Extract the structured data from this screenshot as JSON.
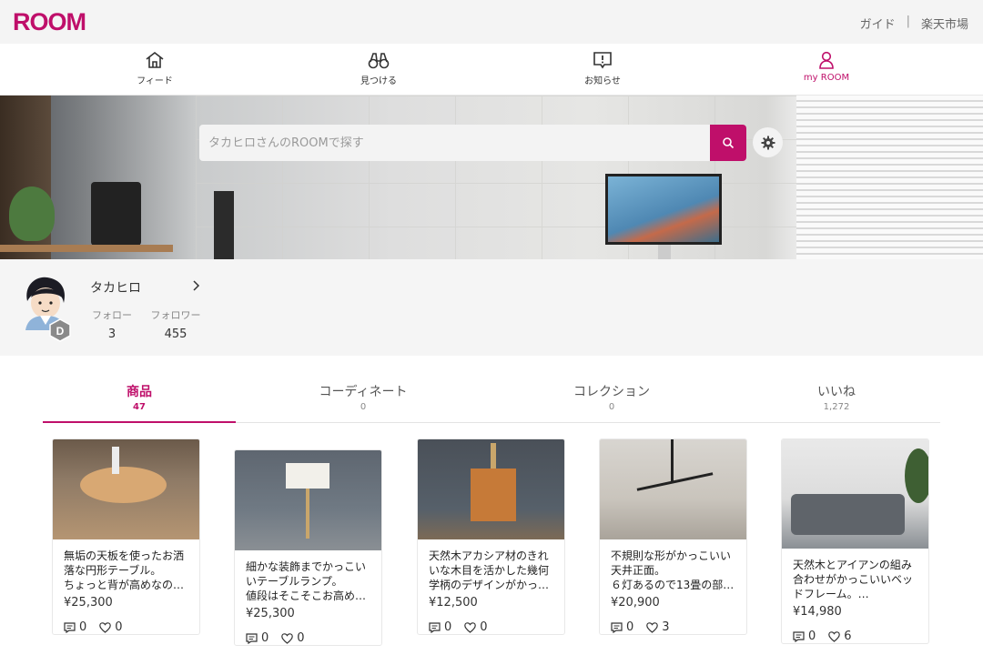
{
  "header": {
    "logo": "ROOM",
    "links": [
      "ガイド",
      "|",
      "楽天市場"
    ]
  },
  "nav": {
    "items": [
      {
        "label": "フィード",
        "icon": "home-icon"
      },
      {
        "label": "見つける",
        "icon": "binoculars-icon"
      },
      {
        "label": "お知らせ",
        "icon": "notification-icon"
      },
      {
        "label": "my ROOM",
        "icon": "user-icon",
        "active": true
      }
    ]
  },
  "search": {
    "placeholder": "タカヒロさんのROOMで探す"
  },
  "profile": {
    "name": "タカヒロ",
    "badge": "D",
    "follow_label": "フォロー",
    "follow_count": "3",
    "follower_label": "フォロワー",
    "follower_count": "455"
  },
  "tabs": [
    {
      "label": "商品",
      "count": "47",
      "active": true
    },
    {
      "label": "コーディネート",
      "count": "0"
    },
    {
      "label": "コレクション",
      "count": "0"
    },
    {
      "label": "いいね",
      "count": "1,272"
    }
  ],
  "items": [
    {
      "desc_lines": [
        "無垢の天板を使ったお洒",
        "落な円形テーブル。",
        "ちょっと背が高めなの…"
      ],
      "price": "¥25,300",
      "comments": "0",
      "likes": "0"
    },
    {
      "desc_lines": [
        "細かな装飾までかっこい",
        "いテーブルランプ。",
        "値段はそこそこお高め…"
      ],
      "price": "¥25,300",
      "comments": "0",
      "likes": "0"
    },
    {
      "desc_lines": [
        "天然木アカシア材のきれ",
        "いな木目を活かした幾何",
        "学柄のデザインがかっ…"
      ],
      "price": "¥12,500",
      "comments": "0",
      "likes": "0"
    },
    {
      "desc_lines": [
        "不規則な形がかっこいい",
        "天井正面。",
        "６灯あるので13畳の部…"
      ],
      "price": "¥20,900",
      "comments": "0",
      "likes": "3"
    },
    {
      "desc_lines": [
        "天然木とアイアンの組み",
        "合わせがかっこいいベッ",
        "ドフレーム。…"
      ],
      "price": "¥14,980",
      "comments": "0",
      "likes": "6"
    }
  ],
  "colors": {
    "brand": "#bf0f6a"
  }
}
